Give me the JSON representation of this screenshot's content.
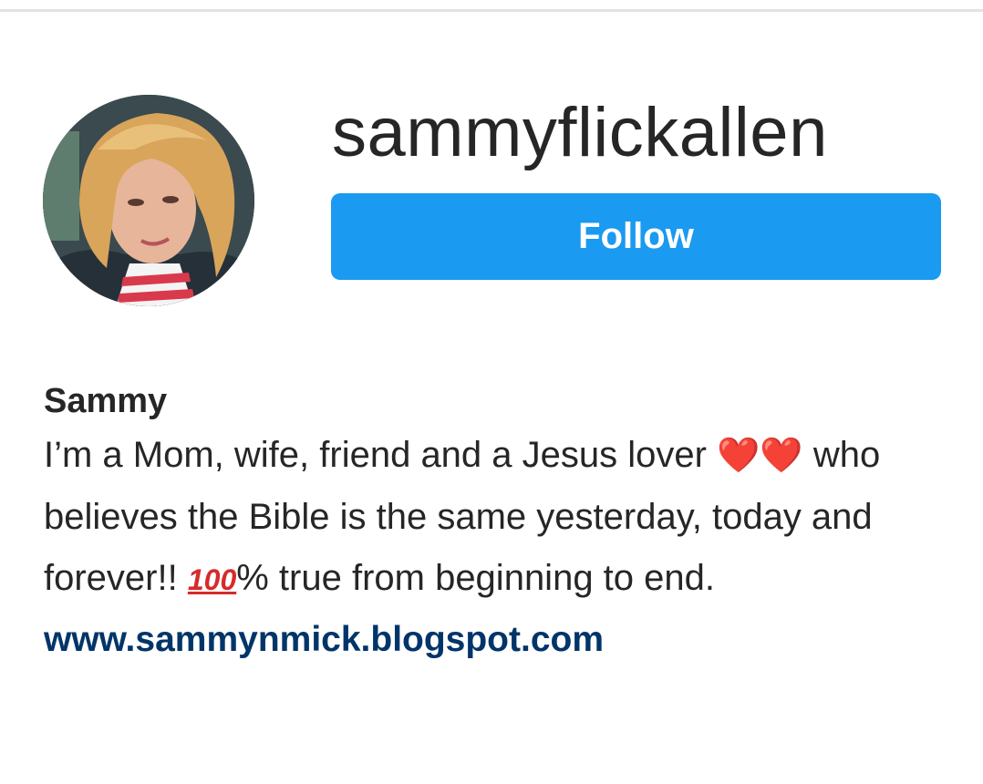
{
  "profile": {
    "username": "sammyflickallen",
    "follow_label": "Follow",
    "full_name": "Sammy",
    "bio": {
      "part1": "I’m a Mom, wife, friend and a Jesus lover ",
      "heart_emoji": "❤️❤️",
      "part2": " who believes the Bible is the same yesterday, today and forever!! ",
      "hundred_emoji": "100",
      "part3": "% true from beginning to end."
    },
    "website": "www.sammynmick.blogspot.com"
  },
  "colors": {
    "follow_button": "#1a9af0",
    "link": "#003569",
    "heart": "#e0141c"
  },
  "icons": {
    "avatar": "profile-photo"
  }
}
